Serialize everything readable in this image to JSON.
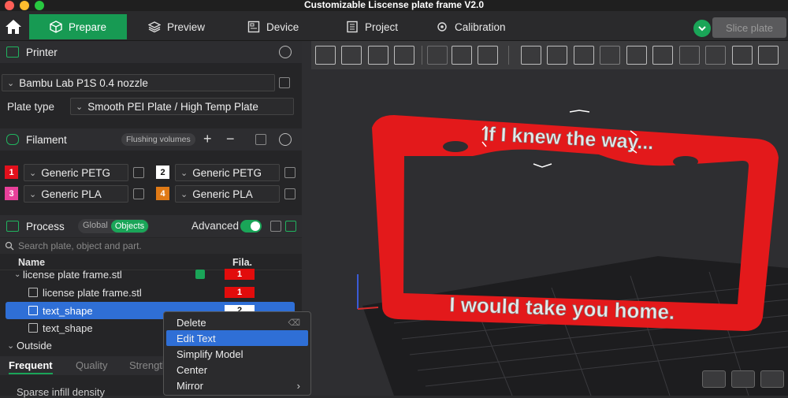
{
  "window": {
    "title": "Customizable Liscense plate frame V2.0"
  },
  "topbar": {
    "tabs": [
      {
        "label": "Prepare"
      },
      {
        "label": "Preview"
      },
      {
        "label": "Device"
      },
      {
        "label": "Project"
      },
      {
        "label": "Calibration"
      }
    ],
    "slice_label": "Slice plate"
  },
  "printer": {
    "title": "Printer",
    "name": "Bambu Lab P1S 0.4 nozzle",
    "plate_label": "Plate type",
    "plate_value": "Smooth PEI Plate / High Temp Plate"
  },
  "filament": {
    "title": "Filament",
    "flush_label": "Flushing volumes",
    "add": "+",
    "remove": "−",
    "slots": [
      {
        "num": "1",
        "name": "Generic PETG",
        "color": "#e2101c"
      },
      {
        "num": "2",
        "name": "Generic PETG",
        "color": "#ffffff"
      },
      {
        "num": "3",
        "name": "Generic PLA",
        "color": "#e8409a"
      },
      {
        "num": "4",
        "name": "Generic PLA",
        "color": "#e07a16"
      }
    ]
  },
  "process": {
    "title": "Process",
    "global_label": "Global",
    "objects_label": "Objects",
    "advanced_label": "Advanced",
    "search_placeholder": "Search plate, object and part.",
    "col_name": "Name",
    "col_fila": "Fila.",
    "tree": [
      {
        "label": "license plate frame.stl",
        "fila": "1"
      },
      {
        "label": "license plate frame.stl",
        "fila": "1"
      },
      {
        "label": "text_shape",
        "fila": "2"
      },
      {
        "label": "text_shape",
        "fila": ""
      },
      {
        "label": "Outside",
        "fila": ""
      }
    ],
    "tabs": [
      "Frequent",
      "Quality",
      "Strength"
    ],
    "setting_label": "Sparse infill density"
  },
  "context_menu": {
    "items": [
      "Delete",
      "Edit Text",
      "Simplify Model",
      "Center",
      "Mirror"
    ]
  },
  "scene": {
    "top_text": "If I knew the way...",
    "bottom_text": "I would take you home.",
    "frame_color": "#e3191b"
  }
}
